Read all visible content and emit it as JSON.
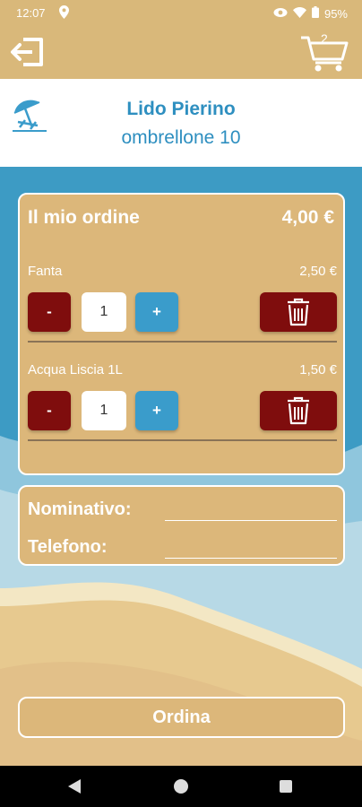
{
  "status_bar": {
    "time": "12:07",
    "battery": "95%"
  },
  "appbar": {
    "cart_count": "2"
  },
  "header": {
    "title": "Lido Pierino",
    "subtitle": "ombrellone 10"
  },
  "order": {
    "title": "Il mio ordine",
    "total": "4,00 €",
    "items": [
      {
        "name": "Fanta",
        "price": "2,50 €",
        "qty": "1",
        "minus": "-",
        "plus": "+"
      },
      {
        "name": "Acqua Liscia 1L",
        "price": "1,50 €",
        "qty": "1",
        "minus": "-",
        "plus": "+"
      }
    ]
  },
  "customer": {
    "name_label": "Nominativo:",
    "phone_label": "Telefono:",
    "name_value": "",
    "phone_value": ""
  },
  "actions": {
    "order_label": "Ordina"
  },
  "colors": {
    "sand": "#dcb77a",
    "sea": "#3d9bc4",
    "dark_red": "#7f0d0d",
    "blue_button": "#3a9ccb",
    "title_blue": "#2e8fc0"
  }
}
